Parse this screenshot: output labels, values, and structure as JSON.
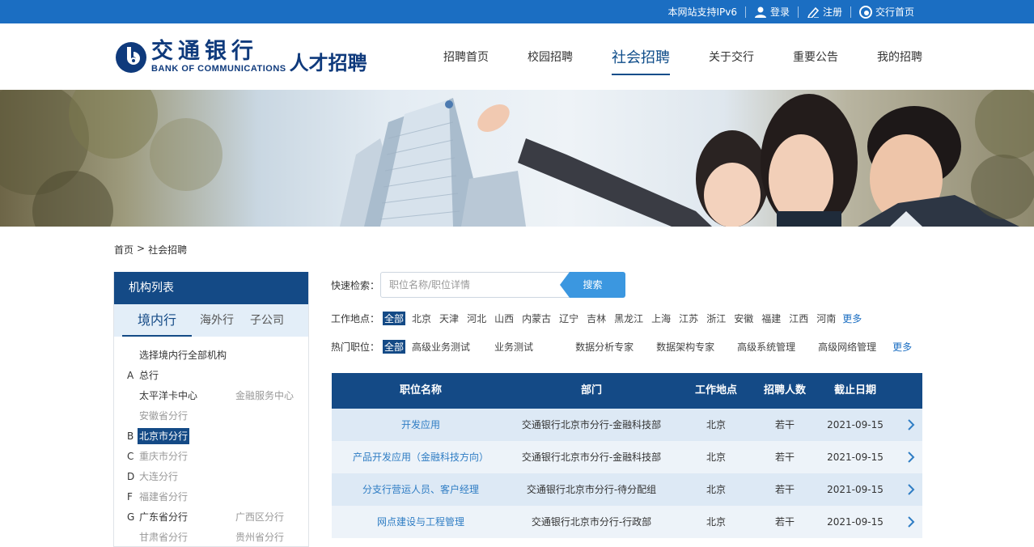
{
  "topbar": {
    "ipv6": "本网站支持IPv6",
    "login": "登录",
    "register": "注册",
    "home": "交行首页",
    "bg_color": "#1b6ec2"
  },
  "header": {
    "logo_cn": "交通银行",
    "logo_en": "BANK OF COMMUNICATIONS",
    "logo_sub": "人才招聘",
    "brand_color": "#0f3a7c",
    "nav": [
      {
        "label": "招聘首页",
        "active": false
      },
      {
        "label": "校园招聘",
        "active": false
      },
      {
        "label": "社会招聘",
        "active": true
      },
      {
        "label": "关于交行",
        "active": false
      },
      {
        "label": "重要公告",
        "active": false
      },
      {
        "label": "我的招聘",
        "active": false
      }
    ]
  },
  "breadcrumb": {
    "home": "首页",
    "separator": ">",
    "current": "社会招聘"
  },
  "sidebar": {
    "title": "机构列表",
    "tabs": [
      "境内行",
      "海外行",
      "子公司"
    ],
    "active_tab": "境内行",
    "items": [
      {
        "letter": "",
        "name": "选择境内行全部机构",
        "name2": "",
        "style": "normal"
      },
      {
        "letter": "A",
        "name": "总行",
        "name2": "",
        "style": "normal"
      },
      {
        "letter": "",
        "name": "太平洋卡中心",
        "name2": "金融服务中心",
        "style": "mixed"
      },
      {
        "letter": "",
        "name": "安徽省分行",
        "name2": "",
        "style": "grey"
      },
      {
        "letter": "B",
        "name": "北京市分行",
        "name2": "",
        "style": "selected"
      },
      {
        "letter": "C",
        "name": "重庆市分行",
        "name2": "",
        "style": "grey"
      },
      {
        "letter": "D",
        "name": "大连分行",
        "name2": "",
        "style": "grey"
      },
      {
        "letter": "F",
        "name": "福建省分行",
        "name2": "",
        "style": "grey"
      },
      {
        "letter": "G",
        "name": "广东省分行",
        "name2": "广西区分行",
        "style": "mixed"
      },
      {
        "letter": "",
        "name": "甘肃省分行",
        "name2": "贵州省分行",
        "style": "grey"
      }
    ],
    "accent_color": "#144a86"
  },
  "search": {
    "label": "快速检索：",
    "placeholder": "职位名称/职位详情",
    "button": "搜索"
  },
  "filters": {
    "location_label": "工作地点：",
    "locations": [
      "全部",
      "北京",
      "天津",
      "河北",
      "山西",
      "内蒙古",
      "辽宁",
      "吉林",
      "黑龙江",
      "上海",
      "江苏",
      "浙江",
      "安徽",
      "福建",
      "江西",
      "河南"
    ],
    "hot_label": "热门职位：",
    "hot_jobs": [
      "全部",
      "高级业务测试",
      "业务测试",
      "数据分析专家",
      "数据架构专家",
      "高级系统管理",
      "高级网络管理"
    ],
    "more": "更多",
    "selected": "全部"
  },
  "jobs": {
    "headers": [
      "职位名称",
      "部门",
      "工作地点",
      "招聘人数",
      "截止日期"
    ],
    "rows": [
      {
        "title": "开发应用",
        "dept": "交通银行北京市分行-金融科技部",
        "location": "北京",
        "count": "若干",
        "deadline": "2021-09-15"
      },
      {
        "title": "产品开发应用（金融科技方向）",
        "dept": "交通银行北京市分行-金融科技部",
        "location": "北京",
        "count": "若干",
        "deadline": "2021-09-15"
      },
      {
        "title": "分支行营运人员、客户经理",
        "dept": "交通银行北京市分行-待分配组",
        "location": "北京",
        "count": "若干",
        "deadline": "2021-09-15"
      },
      {
        "title": "网点建设与工程管理",
        "dept": "交通银行北京市分行-行政部",
        "location": "北京",
        "count": "若干",
        "deadline": "2021-09-15"
      }
    ]
  }
}
